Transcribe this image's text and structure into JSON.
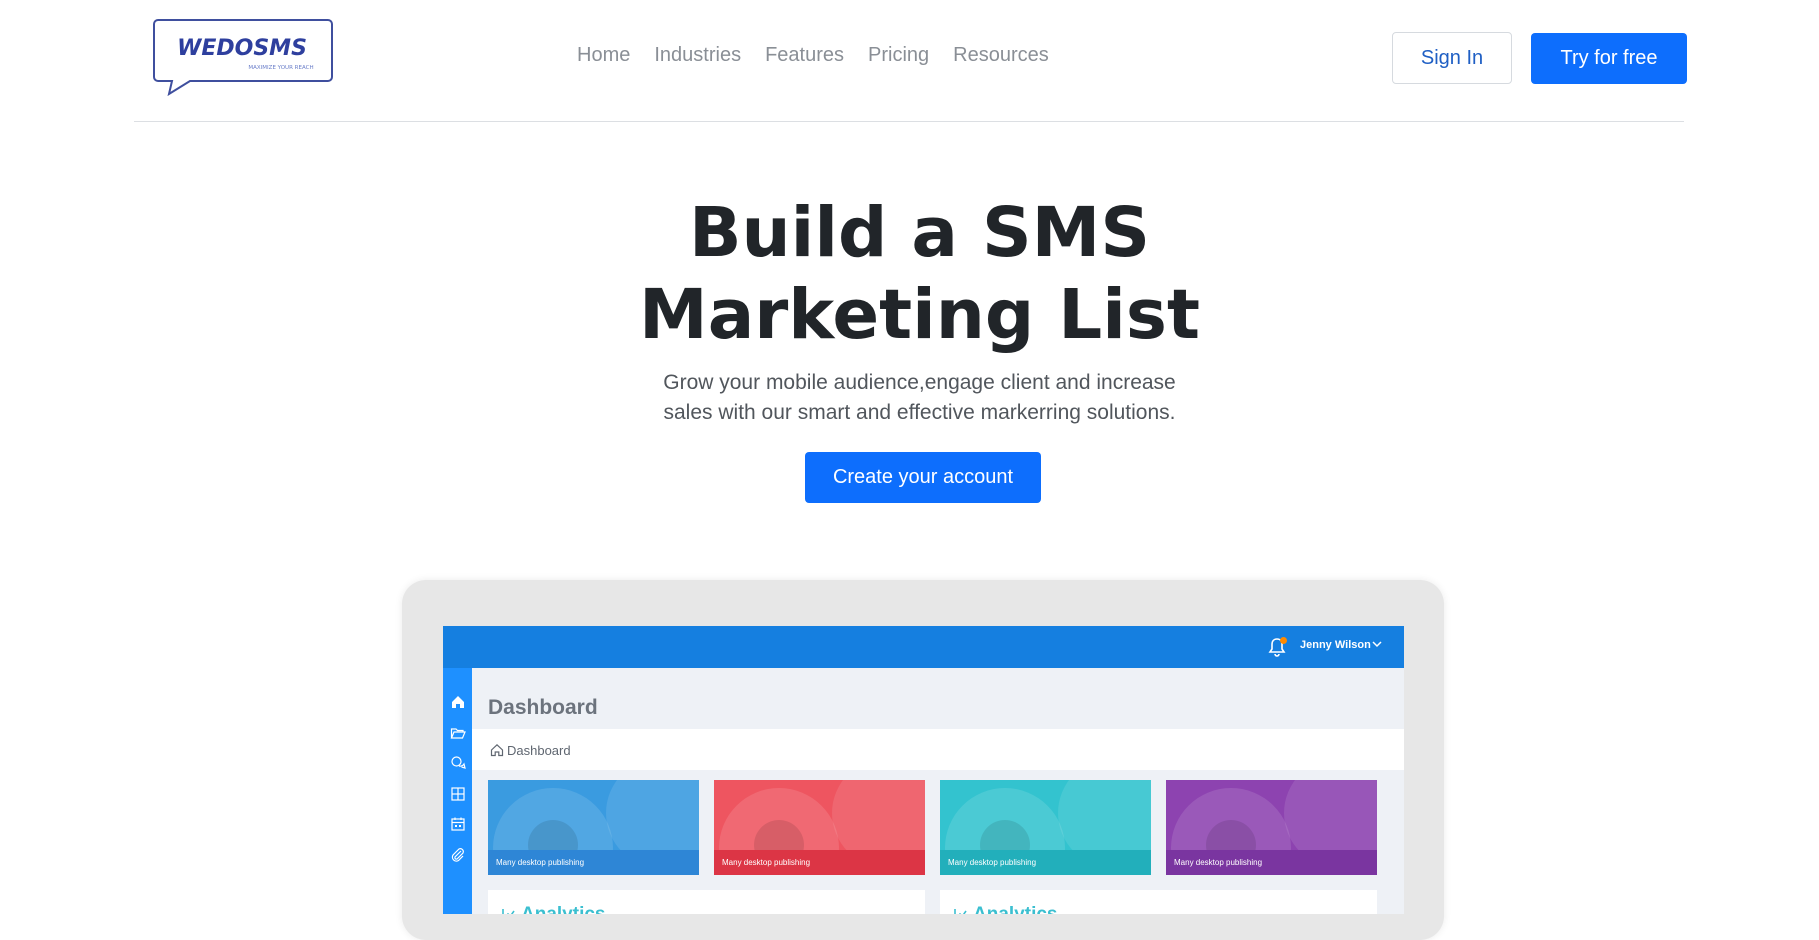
{
  "brand": {
    "logo_text": "WEDOSMS",
    "logo_tagline": "MAXIMIZE YOUR REACH",
    "accent": "#0d6efd",
    "logo_color": "#2e3f9e"
  },
  "nav": {
    "items": [
      {
        "label": "Home"
      },
      {
        "label": "Industries"
      },
      {
        "label": "Features"
      },
      {
        "label": "Pricing"
      },
      {
        "label": "Resources"
      }
    ]
  },
  "header": {
    "sign_in_label": "Sign In",
    "try_label": "Try for free"
  },
  "hero": {
    "title_line1": "Build a SMS",
    "title_line2": "Marketing List",
    "subtitle_line1": "Grow your mobile audience,engage client and increase",
    "subtitle_line2": "sales with our smart and effective markerring solutions.",
    "cta_label": "Create your account"
  },
  "mockup": {
    "user_name": "Jenny Wilson",
    "page_title": "Dashboard",
    "breadcrumb": "Dashboard",
    "sidebar_icons": [
      "home-icon",
      "folder-icon",
      "chat-icon",
      "grid-icon",
      "calendar-icon",
      "paperclip-icon"
    ],
    "cards": [
      {
        "label": "Many desktop publishing",
        "color": "#3a9be0",
        "strip": "#2e86d6"
      },
      {
        "label": "Many desktop publishing",
        "color": "#ee5560",
        "strip": "#dc3545"
      },
      {
        "label": "Many desktop publishing",
        "color": "#33c3cf",
        "strip": "#22afbb"
      },
      {
        "label": "Many desktop publishing",
        "color": "#8d43b0",
        "strip": "#7a35a0"
      }
    ],
    "panels": [
      {
        "title": "Analytics"
      },
      {
        "title": "Analytics"
      }
    ]
  }
}
